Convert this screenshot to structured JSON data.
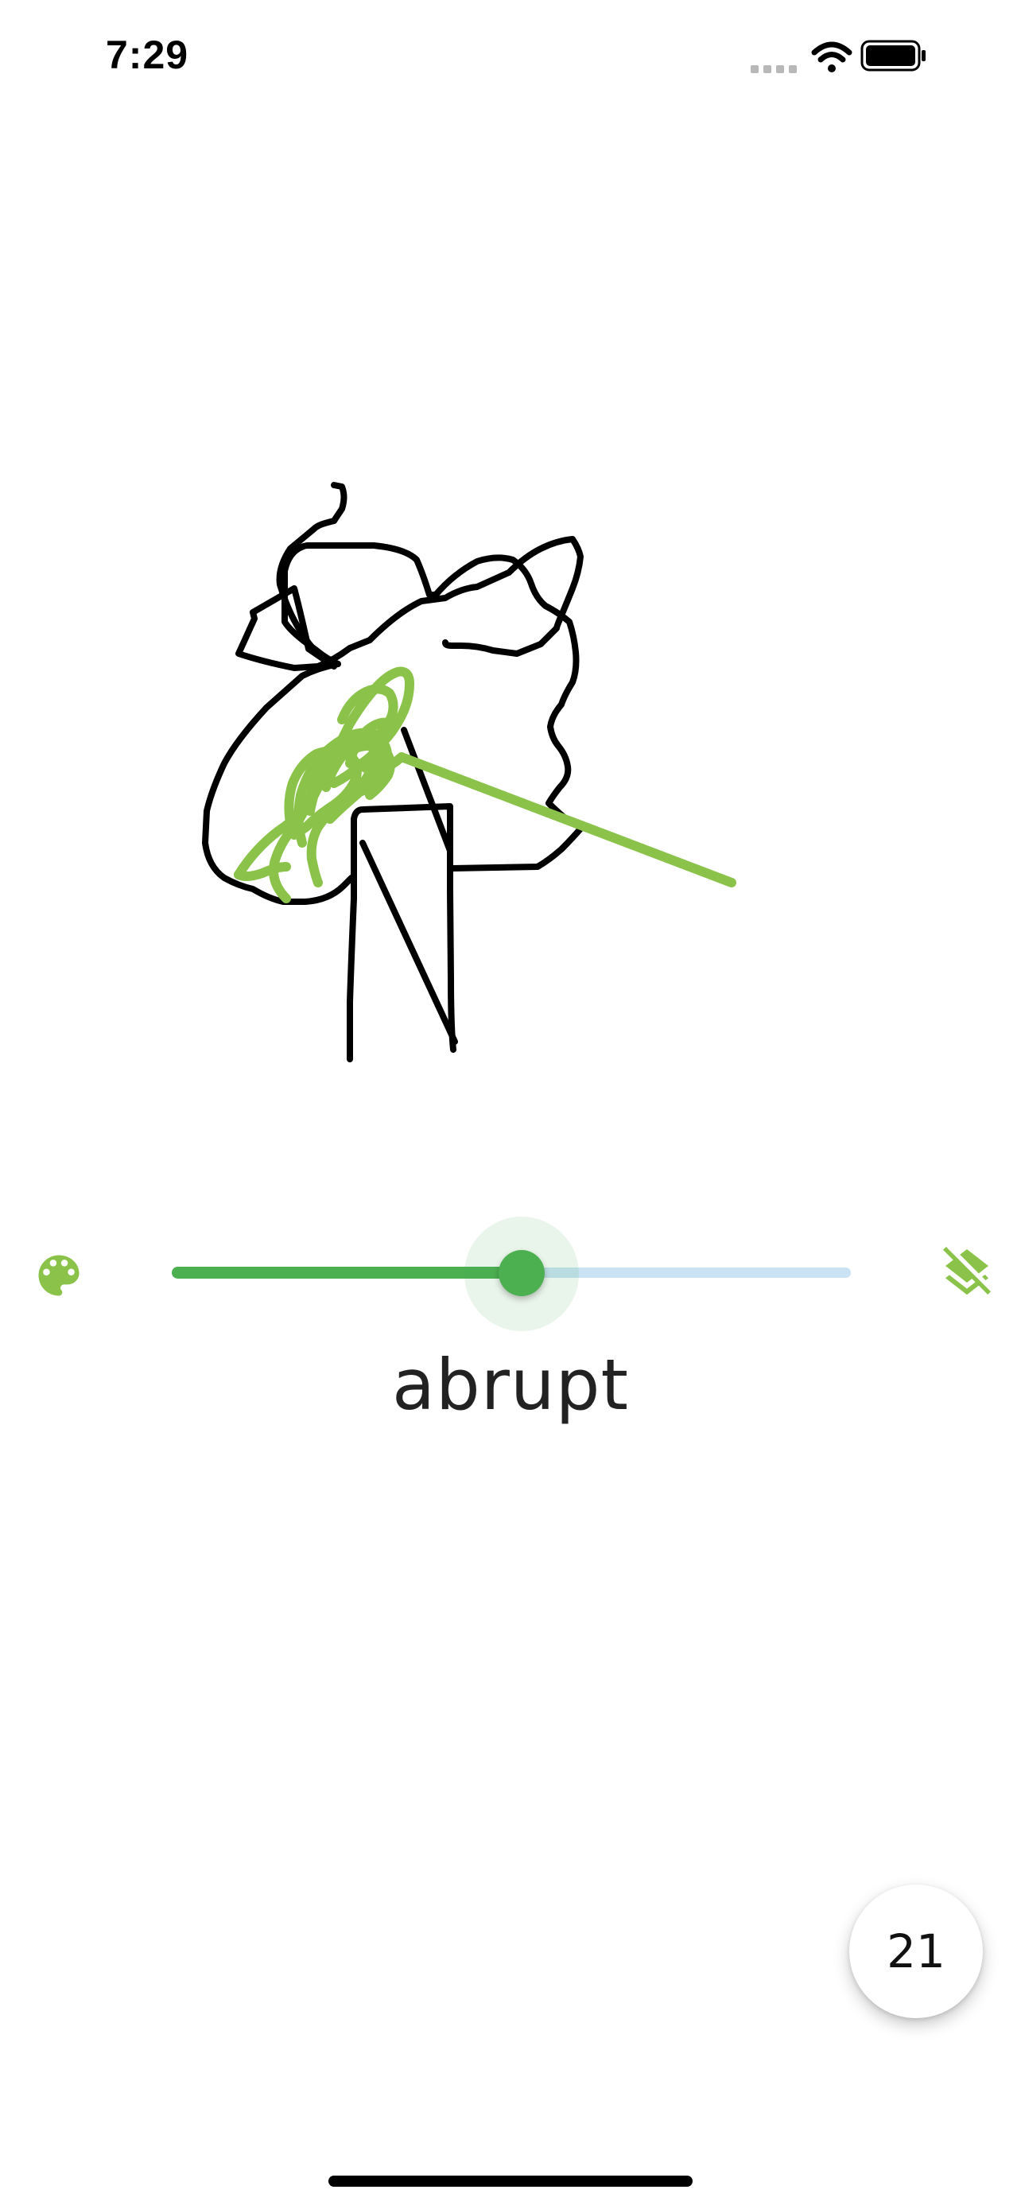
{
  "status_bar": {
    "time": "7:29"
  },
  "icons": {
    "palette": "palette-icon",
    "layers": "layers-clear-icon",
    "wifi": "wifi-icon",
    "battery": "battery-icon",
    "signal": "cellular-signal-icon"
  },
  "colors": {
    "accent": "#4caf50",
    "icon_green": "#8bc34a",
    "stroke_black": "#000000",
    "stroke_green": "#8bc34a",
    "track_inactive": "#c9e3f5"
  },
  "slider": {
    "value": 0.515
  },
  "word": "abrupt",
  "counter": "21"
}
